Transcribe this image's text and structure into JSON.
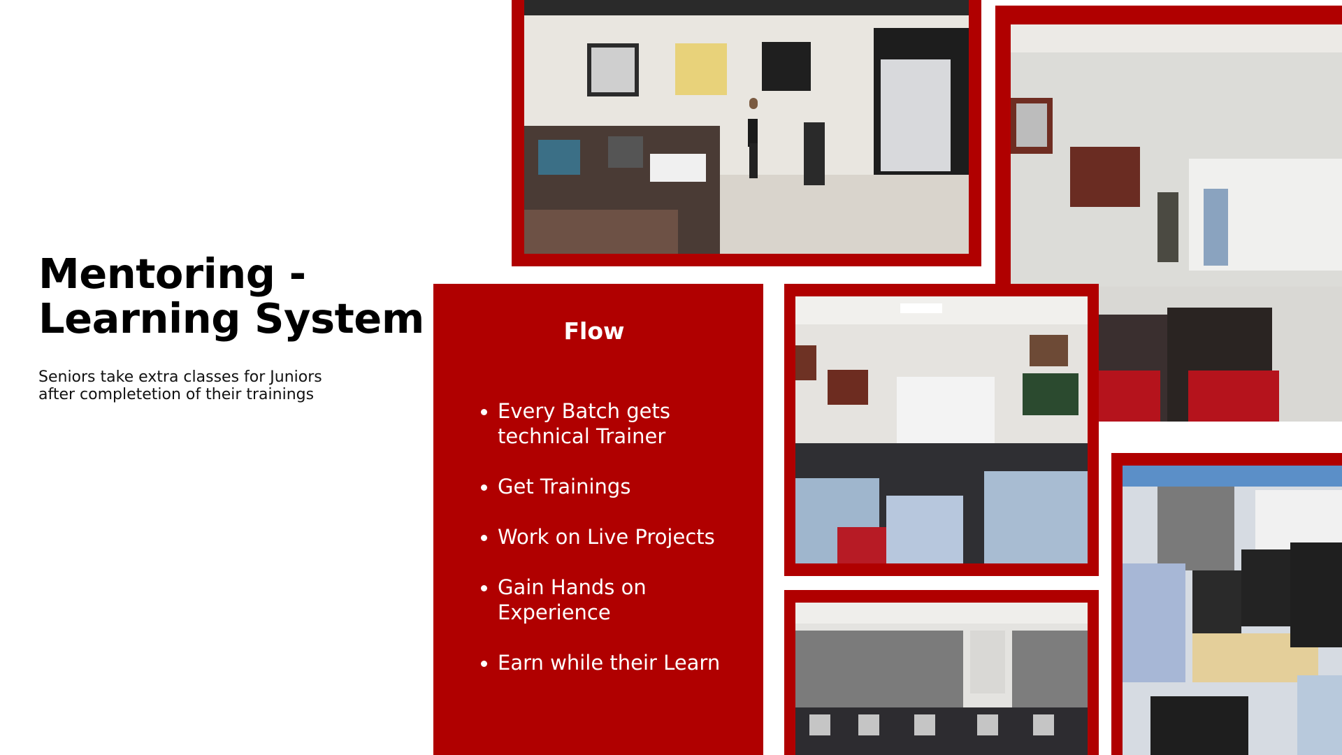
{
  "slide": {
    "title": "Mentoring -\nLearning System",
    "subtitle": "Seniors take extra classes for Juniors after completetion of their trainings"
  },
  "flow": {
    "heading": "Flow",
    "items": [
      "Every Batch gets technical Trainer",
      "Get Trainings",
      "Work on Live Projects",
      "Gain Hands on Experience",
      "Earn while their Learn"
    ]
  },
  "colors": {
    "accent": "#b00000",
    "background": "#ffffff",
    "text": "#000000"
  },
  "photos": [
    {
      "name": "classroom-lecture-photo"
    },
    {
      "name": "whiteboard-session-photo"
    },
    {
      "name": "student-whiteboard-photo"
    },
    {
      "name": "computer-lab-photo"
    },
    {
      "name": "group-study-photo"
    }
  ]
}
